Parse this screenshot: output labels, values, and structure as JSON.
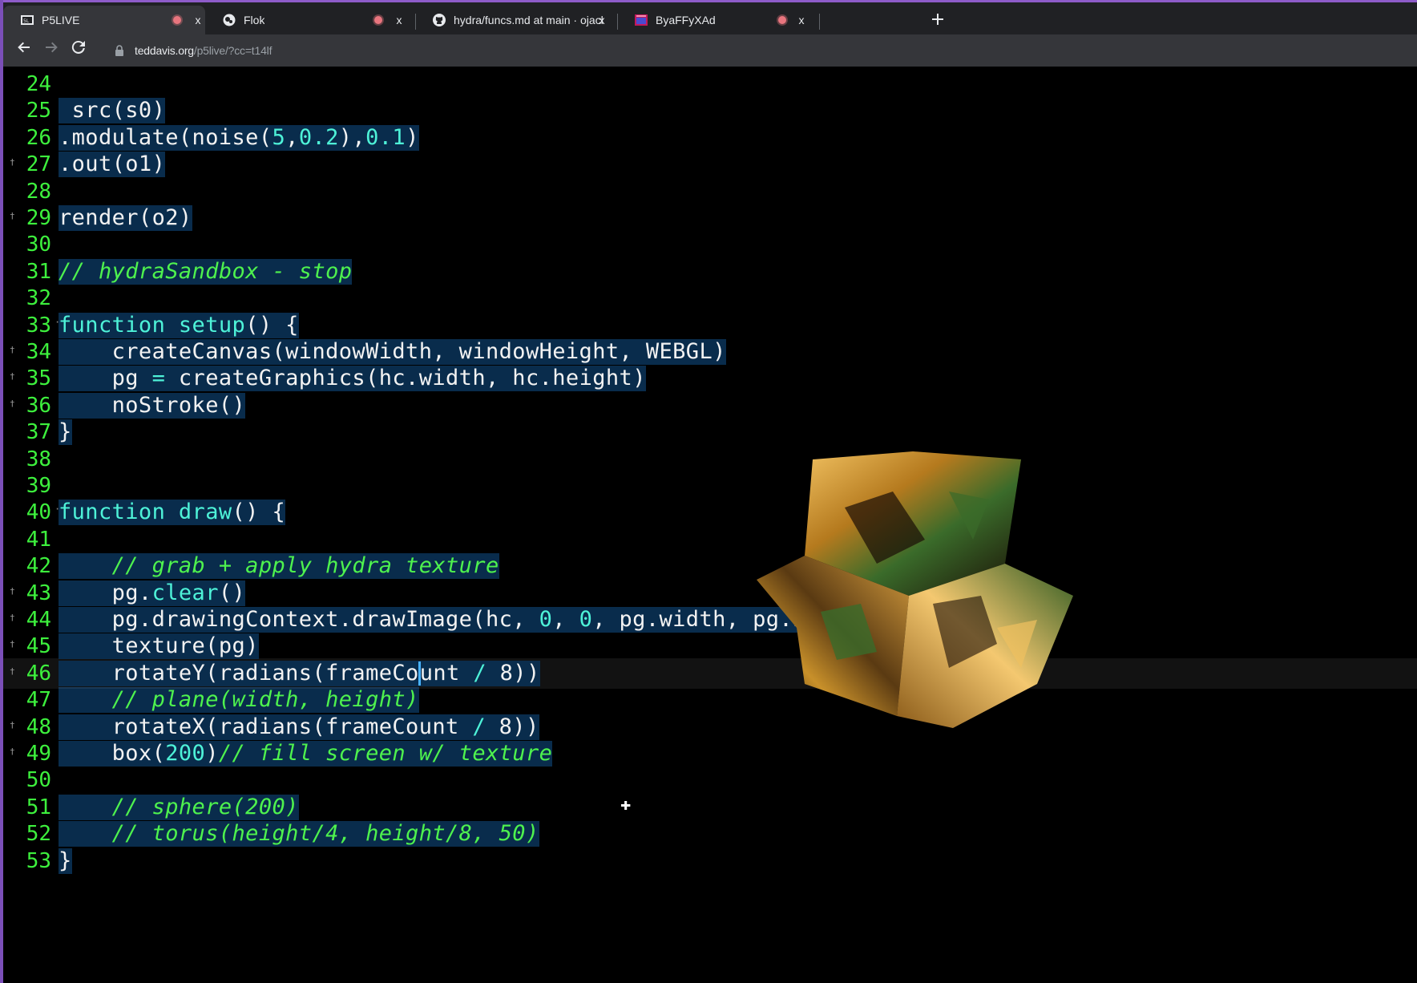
{
  "browser": {
    "tabs": [
      {
        "title": "P5LIVE",
        "favicon": "p5live-logo-icon",
        "recording": true,
        "active": true
      },
      {
        "title": "Flok",
        "favicon": "flok-logo-icon",
        "recording": true,
        "active": false
      },
      {
        "title": "hydra/funcs.md at main · ojack/h",
        "favicon": "github-icon",
        "recording": false,
        "active": false
      },
      {
        "title": "ByaFFyXAd",
        "favicon": "window-icon",
        "recording": true,
        "active": false
      }
    ],
    "new_tab_icon": "plus-icon",
    "close_icon": "x",
    "url_host": "teddavis.org",
    "url_path": "/p5live/?cc=t14lf"
  },
  "editor": {
    "line_numbers": [
      "24",
      "25",
      "26",
      "27",
      "28",
      "29",
      "30",
      "31",
      "32",
      "33",
      "34",
      "35",
      "36",
      "37",
      "38",
      "39",
      "40",
      "41",
      "42",
      "43",
      "44",
      "45",
      "46",
      "47",
      "48",
      "49",
      "50",
      "51",
      "52",
      "53"
    ],
    "lines": [
      {
        "n": "24",
        "tokens": []
      },
      {
        "n": "25",
        "tokens": [
          {
            "t": " src(s0)",
            "c": "def"
          }
        ]
      },
      {
        "n": "26",
        "tokens": [
          {
            "t": ".modulate(noise(",
            "c": "def"
          },
          {
            "t": "5",
            "c": "num"
          },
          {
            "t": ",",
            "c": "def"
          },
          {
            "t": "0.2",
            "c": "num"
          },
          {
            "t": "),",
            "c": "def"
          },
          {
            "t": "0.1",
            "c": "num"
          },
          {
            "t": ")",
            "c": "def"
          }
        ]
      },
      {
        "n": "27",
        "tokens": [
          {
            "t": ".out(o1)",
            "c": "def"
          }
        ]
      },
      {
        "n": "28",
        "tokens": []
      },
      {
        "n": "29",
        "tokens": [
          {
            "t": "render(o2)",
            "c": "def"
          }
        ]
      },
      {
        "n": "30",
        "tokens": []
      },
      {
        "n": "31",
        "tokens": [
          {
            "t": "// hydraSandbox - stop",
            "c": "cm"
          }
        ]
      },
      {
        "n": "32",
        "tokens": []
      },
      {
        "n": "33",
        "tokens": [
          {
            "t": "function",
            "c": "kw"
          },
          {
            "t": " ",
            "c": "def"
          },
          {
            "t": "setup",
            "c": "kw"
          },
          {
            "t": "() {",
            "c": "def"
          }
        ]
      },
      {
        "n": "34",
        "tokens": [
          {
            "t": "    createCanvas(windowWidth, windowHeight, WEBGL)",
            "c": "def"
          }
        ]
      },
      {
        "n": "35",
        "tokens": [
          {
            "t": "    pg ",
            "c": "def"
          },
          {
            "t": "=",
            "c": "op"
          },
          {
            "t": " createGraphics(hc.width, hc.height)",
            "c": "def"
          }
        ]
      },
      {
        "n": "36",
        "tokens": [
          {
            "t": "    noStroke()",
            "c": "def"
          }
        ]
      },
      {
        "n": "37",
        "tokens": [
          {
            "t": "}",
            "c": "def"
          }
        ]
      },
      {
        "n": "38",
        "tokens": []
      },
      {
        "n": "39",
        "tokens": []
      },
      {
        "n": "40",
        "tokens": [
          {
            "t": "function",
            "c": "kw"
          },
          {
            "t": " ",
            "c": "def"
          },
          {
            "t": "draw",
            "c": "kw"
          },
          {
            "t": "() {",
            "c": "def"
          }
        ]
      },
      {
        "n": "41",
        "tokens": []
      },
      {
        "n": "42",
        "tokens": [
          {
            "t": "    ",
            "c": "def"
          },
          {
            "t": "// grab + apply hydra texture",
            "c": "cm"
          }
        ]
      },
      {
        "n": "43",
        "tokens": [
          {
            "t": "    pg.",
            "c": "def"
          },
          {
            "t": "clear",
            "c": "kw"
          },
          {
            "t": "()",
            "c": "def"
          }
        ]
      },
      {
        "n": "44",
        "tokens": [
          {
            "t": "    pg.drawingContext.drawImage(hc, ",
            "c": "def"
          },
          {
            "t": "0",
            "c": "num"
          },
          {
            "t": ", ",
            "c": "def"
          },
          {
            "t": "0",
            "c": "num"
          },
          {
            "t": ", pg.width, pg.height)",
            "c": "def"
          }
        ]
      },
      {
        "n": "45",
        "tokens": [
          {
            "t": "    texture(pg)",
            "c": "def"
          }
        ]
      },
      {
        "n": "46",
        "tokens": [
          {
            "t": "    rotateY(radians(frameCo",
            "c": "def"
          },
          {
            "t": "|",
            "c": "caret"
          },
          {
            "t": "unt ",
            "c": "def"
          },
          {
            "t": "/",
            "c": "op"
          },
          {
            "t": " 8))",
            "c": "def"
          }
        ]
      },
      {
        "n": "47",
        "tokens": [
          {
            "t": "    ",
            "c": "def"
          },
          {
            "t": "// plane(width, height)",
            "c": "cm"
          }
        ]
      },
      {
        "n": "48",
        "tokens": [
          {
            "t": "    rotateX(radians(frameCount ",
            "c": "def"
          },
          {
            "t": "/",
            "c": "op"
          },
          {
            "t": " 8))",
            "c": "def"
          }
        ]
      },
      {
        "n": "49",
        "tokens": [
          {
            "t": "    box(",
            "c": "def"
          },
          {
            "t": "200",
            "c": "num"
          },
          {
            "t": ")",
            "c": "def"
          },
          {
            "t": "// fill screen w/ texture",
            "c": "cm"
          }
        ]
      },
      {
        "n": "50",
        "tokens": []
      },
      {
        "n": "51",
        "tokens": [
          {
            "t": "    ",
            "c": "def"
          },
          {
            "t": "// sphere(200)",
            "c": "cm"
          }
        ]
      },
      {
        "n": "52",
        "tokens": [
          {
            "t": "    ",
            "c": "def"
          },
          {
            "t": "// torus(height/4, height/8, 50)",
            "c": "cm"
          }
        ]
      },
      {
        "n": "53",
        "tokens": [
          {
            "t": "}",
            "c": "def"
          }
        ]
      }
    ],
    "fold_lines": [
      "33",
      "40"
    ],
    "marked_lines": [
      "27",
      "29",
      "34",
      "35",
      "36",
      "43",
      "44",
      "45",
      "46",
      "48",
      "49"
    ],
    "current_line": "46"
  },
  "preview": {
    "shape": "textured rotating cube",
    "colors": [
      "#c8902a",
      "#3a6b2a",
      "#f0c060",
      "#1a0d05"
    ]
  },
  "colors": {
    "line_number": "#3df03d",
    "keyword": "#4ef2d8",
    "comment": "#4ef24e",
    "code": "#f2f2f2",
    "code_bg": "#0a3052",
    "frame": "#8e5cc9"
  }
}
